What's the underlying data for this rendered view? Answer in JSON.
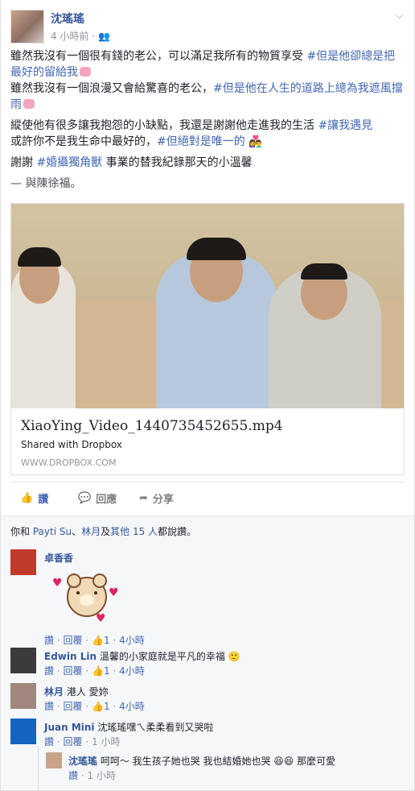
{
  "post": {
    "author": "沈瑤瑤",
    "time": "4 小時前",
    "privacy_separator": "·",
    "paragraphs": [
      {
        "text": "雖然我沒有一個很有錢的老公，可以滿足我所有的物質享受 ",
        "tag": "#但是他卻總是把最好的留給我"
      },
      {
        "text": "雖然我沒有一個浪漫又會給驚喜的老公，",
        "tag": "#但是他在人生的道路上總為我遮風擋雨"
      },
      {
        "text": "縱使他有很多讓我抱怨的小缺點，我還是謝謝他走進我的生活 ",
        "tag": "#讓我遇見",
        "text2": "或許你不是我生命中最好的，",
        "tag2": "#但絕對是唯一的"
      },
      {
        "text": "謝謝 ",
        "tag": "#婚攝獨角獸",
        "text2": " 事業的替我紀錄那天的小溫馨"
      }
    ],
    "with_text": "— 與陳徐福。"
  },
  "link_card": {
    "title": "XiaoYing_Video_1440735452655.mp4",
    "subtitle": "Shared with Dropbox",
    "domain": "WWW.DROPBOX.COM"
  },
  "actions": {
    "like": "讚",
    "comment": "回應",
    "share": "分享"
  },
  "likes": {
    "prefix": "你和",
    "name1": "Payti Su",
    "sep": "、",
    "name2": "林月",
    "mid": "及",
    "others": "其他 15 人",
    "suffix": "都說讚。"
  },
  "comments": [
    {
      "name": "卓香香",
      "text": "",
      "likes": "1",
      "time": "4小時"
    },
    {
      "name": "Edwin Lin",
      "text": "溫馨的小家庭就是平凡的幸福 🙂",
      "likes": "1",
      "time": "4小時"
    },
    {
      "name": "林月",
      "text": "港人 愛妳",
      "likes": "1",
      "time": "4小時"
    },
    {
      "name": "Juan Mini",
      "text": "沈瑤瑤嘿ㄟ柔柔看到又哭啦",
      "likes": "",
      "time": "1 小時"
    },
    {
      "name": "沈瑤瑤",
      "text": "呵呵～ 我生孩子她也哭 我也結婚她也哭 😆😆 那麼可愛",
      "likes": "",
      "time": "1 小時"
    }
  ],
  "comment_meta": {
    "like": "讚",
    "reply": "回覆",
    "sep": "·"
  }
}
